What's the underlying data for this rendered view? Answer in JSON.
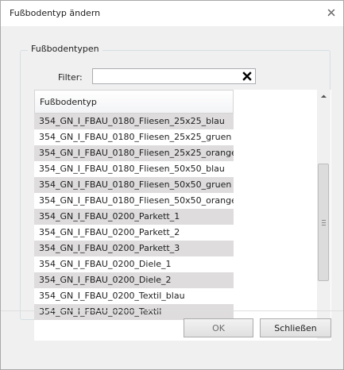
{
  "window": {
    "title": "Fußbodentyp ändern",
    "close_icon": "close-icon"
  },
  "groupbox": {
    "title": "Fußbodentypen"
  },
  "filter": {
    "label": "Filter:",
    "value": "",
    "placeholder": "",
    "clear_icon": "clear-icon"
  },
  "list": {
    "header": "Fußbodentyp",
    "items": [
      "354_GN_I_FBAU_0180_Fliesen_25x25_blau",
      "354_GN_I_FBAU_0180_Fliesen_25x25_gruen",
      "354_GN_I_FBAU_0180_Fliesen_25x25_orange",
      "354_GN_I_FBAU_0180_Fliesen_50x50_blau",
      "354_GN_I_FBAU_0180_Fliesen_50x50_gruen",
      "354_GN_I_FBAU_0180_Fliesen_50x50_orange",
      "354_GN_I_FBAU_0200_Parkett_1",
      "354_GN_I_FBAU_0200_Parkett_2",
      "354_GN_I_FBAU_0200_Parkett_3",
      "354_GN_I_FBAU_0200_Diele_1",
      "354_GN_I_FBAU_0200_Diele_2",
      "354_GN_I_FBAU_0200_Textil_blau",
      "354_GN_I_FBAU_0200_Textil"
    ]
  },
  "buttons": {
    "ok": "OK",
    "close": "Schließen"
  },
  "colors": {
    "alt_row": "#dedcdc",
    "background": "#f0f0f0"
  }
}
